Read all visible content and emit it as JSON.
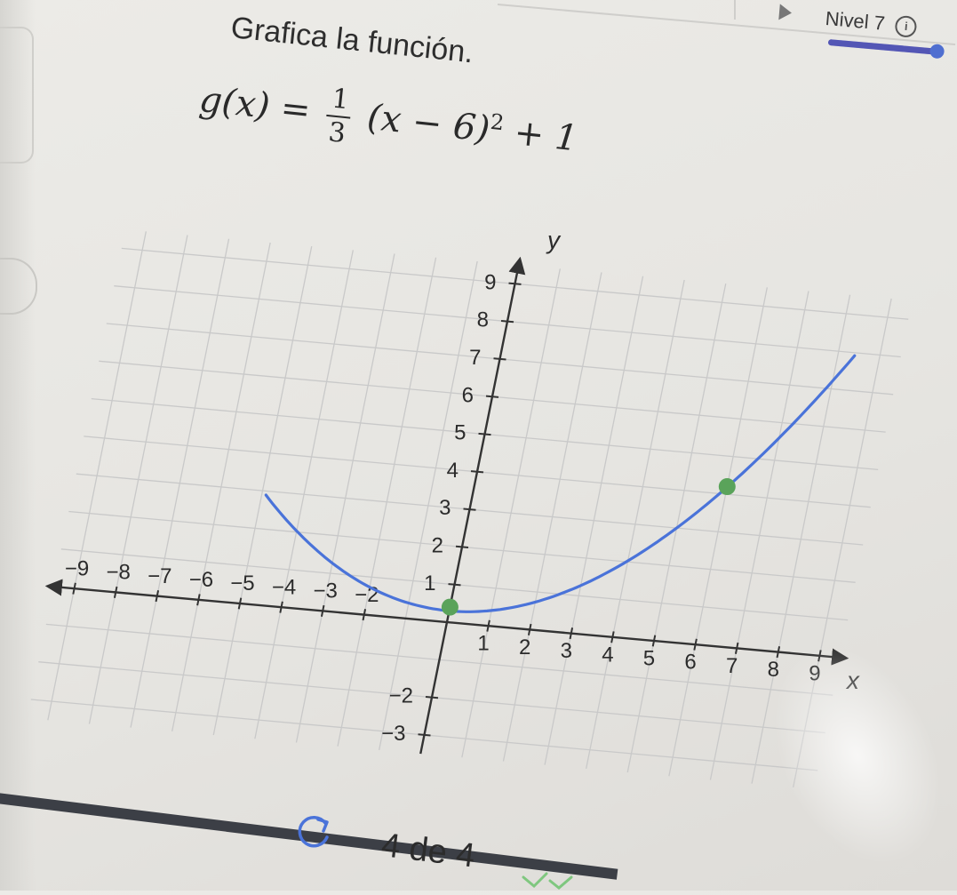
{
  "header": {
    "level_label": "Nivel 7",
    "info_icon": "info-icon",
    "level_progress": 1.0,
    "accent_color": "#5356b5"
  },
  "problem": {
    "instruction": "Grafica la función.",
    "formula": {
      "lhs": "g(x) =",
      "fraction_numerator": "1",
      "fraction_denominator": "3",
      "body": "(x − 6)",
      "exponent": "2",
      "tail": "+ 1"
    }
  },
  "chart_data": {
    "type": "line",
    "xlabel": "x",
    "ylabel": "y",
    "xlim": [
      -9.5,
      9.5
    ],
    "ylim": [
      -3.5,
      9.5
    ],
    "x_ticks": [
      -9,
      -8,
      -7,
      -6,
      -5,
      -4,
      -3,
      -2,
      1,
      2,
      3,
      4,
      5,
      6,
      7,
      8,
      9
    ],
    "x_tick_labels": [
      "−9",
      "−8",
      "−7",
      "−6",
      "−5",
      "−4",
      "−3",
      "−2",
      "1",
      "2",
      "3",
      "4",
      "5",
      "6",
      "7",
      "8",
      "9"
    ],
    "y_ticks": [
      -3,
      -2,
      1,
      2,
      3,
      4,
      5,
      6,
      7,
      8,
      9
    ],
    "y_tick_labels": [
      "−3",
      "−2",
      "1",
      "2",
      "3",
      "4",
      "5",
      "6",
      "7",
      "8",
      "9"
    ],
    "grid": true,
    "series_color": "#4a73d9",
    "point_color": "#5aa35a",
    "points": [
      {
        "x": 0,
        "y": 0.4
      },
      {
        "x": 6,
        "y": 4.2
      }
    ],
    "curve": {
      "vertex_x": 0,
      "vertex_y": 0.3,
      "a": 0.108
    }
  },
  "footer": {
    "reset_icon": "reset-icon",
    "page_count": "4 de 4",
    "check_icon": "check-icon"
  }
}
